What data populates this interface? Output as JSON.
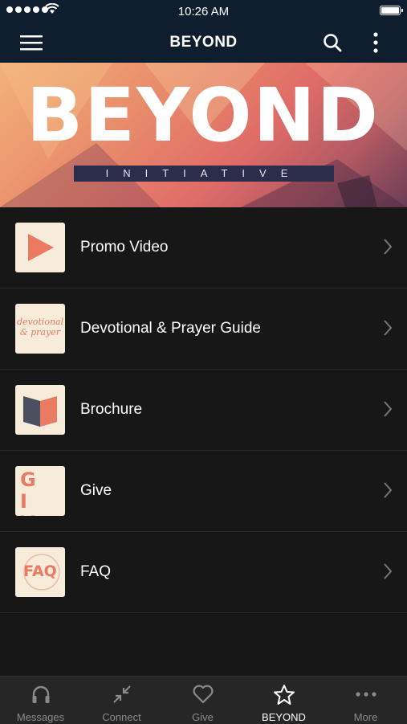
{
  "status_bar": {
    "time": "10:26 AM"
  },
  "nav": {
    "title": "BEYOND",
    "menu_icon": "hamburger-menu-icon",
    "search_icon": "search-icon",
    "more_icon": "vertical-dots-icon"
  },
  "banner": {
    "word": "BEYOND",
    "subtitle": "INITIATIVE"
  },
  "list": {
    "items": [
      {
        "label": "Promo Video",
        "icon": "play-thumbnail"
      },
      {
        "label": "Devotional & Prayer Guide",
        "icon": "devotional-thumbnail",
        "thumb_text": "devotional & prayer"
      },
      {
        "label": "Brochure",
        "icon": "brochure-thumbnail"
      },
      {
        "label": "Give",
        "icon": "give-thumbnail",
        "thumb_text": "GIVE"
      },
      {
        "label": "FAQ",
        "icon": "faq-thumbnail",
        "thumb_text": "FAQ"
      }
    ]
  },
  "tabs": [
    {
      "label": "Messages",
      "icon": "headphones-icon"
    },
    {
      "label": "Connect",
      "icon": "connect-arrows-icon"
    },
    {
      "label": "Give",
      "icon": "heart-icon"
    },
    {
      "label": "BEYOND",
      "icon": "star-icon",
      "active": true
    },
    {
      "label": "More",
      "icon": "more-dots-icon"
    }
  ],
  "colors": {
    "nav_bg": "#0f1e2e",
    "list_bg": "#171717",
    "tab_bg": "#262626",
    "accent": "#ea7a62",
    "thumb_bg": "#f6ecd9"
  }
}
